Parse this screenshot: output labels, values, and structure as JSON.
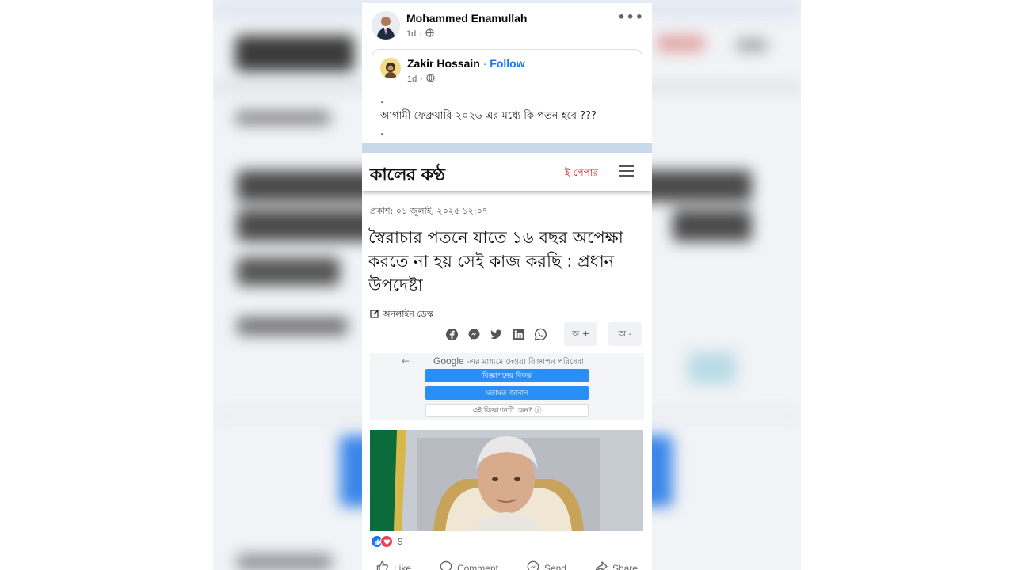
{
  "post": {
    "author": "Mohammed Enamullah",
    "time": "1d",
    "more_label": "•••"
  },
  "shared_post": {
    "author": "Zakir Hossain",
    "separator": " · ",
    "follow_label": "Follow",
    "time": "1d",
    "line1": ".",
    "text": "আগামী ফেব্রুয়ারি ২০২৬ এর মধ্যে কি পতন হবে ???",
    "line3": "."
  },
  "article": {
    "logo": "কালের কণ্ঠ",
    "epaper_label": "ই-পেপার",
    "pubdate": "প্রকাশ: ০১ জুলাই, ২০২৫ ১২:০৭",
    "headline": "স্বৈরাচার পতনে যাতে ১৬ বছর অপেক্ষা করতে না হয় সেই কাজ করছি : প্রধান উপদেষ্টা",
    "desk": "অনলাইন ডেস্ক",
    "font_increase": "অ +",
    "font_decrease": "অ -",
    "ad": {
      "back": "←",
      "title_brand": "Google",
      "title_rest": " -এর মাধ্যমে দেওয়া বিজ্ঞাপন পরিষেবা",
      "btn1": "বিজ্ঞাপনের বিকল্প",
      "btn2": "মতামত জানান",
      "btn3": "এই বিজ্ঞাপনটি কেন? ⓘ"
    }
  },
  "reactions": {
    "count": "9"
  },
  "actions": {
    "like": "Like",
    "comment": "Comment",
    "send": "Send",
    "share": "Share"
  },
  "colors": {
    "facebook_blue": "#1877f2",
    "epaper_red": "#cc1f1f",
    "ad_button_blue": "#2a8ef7"
  }
}
